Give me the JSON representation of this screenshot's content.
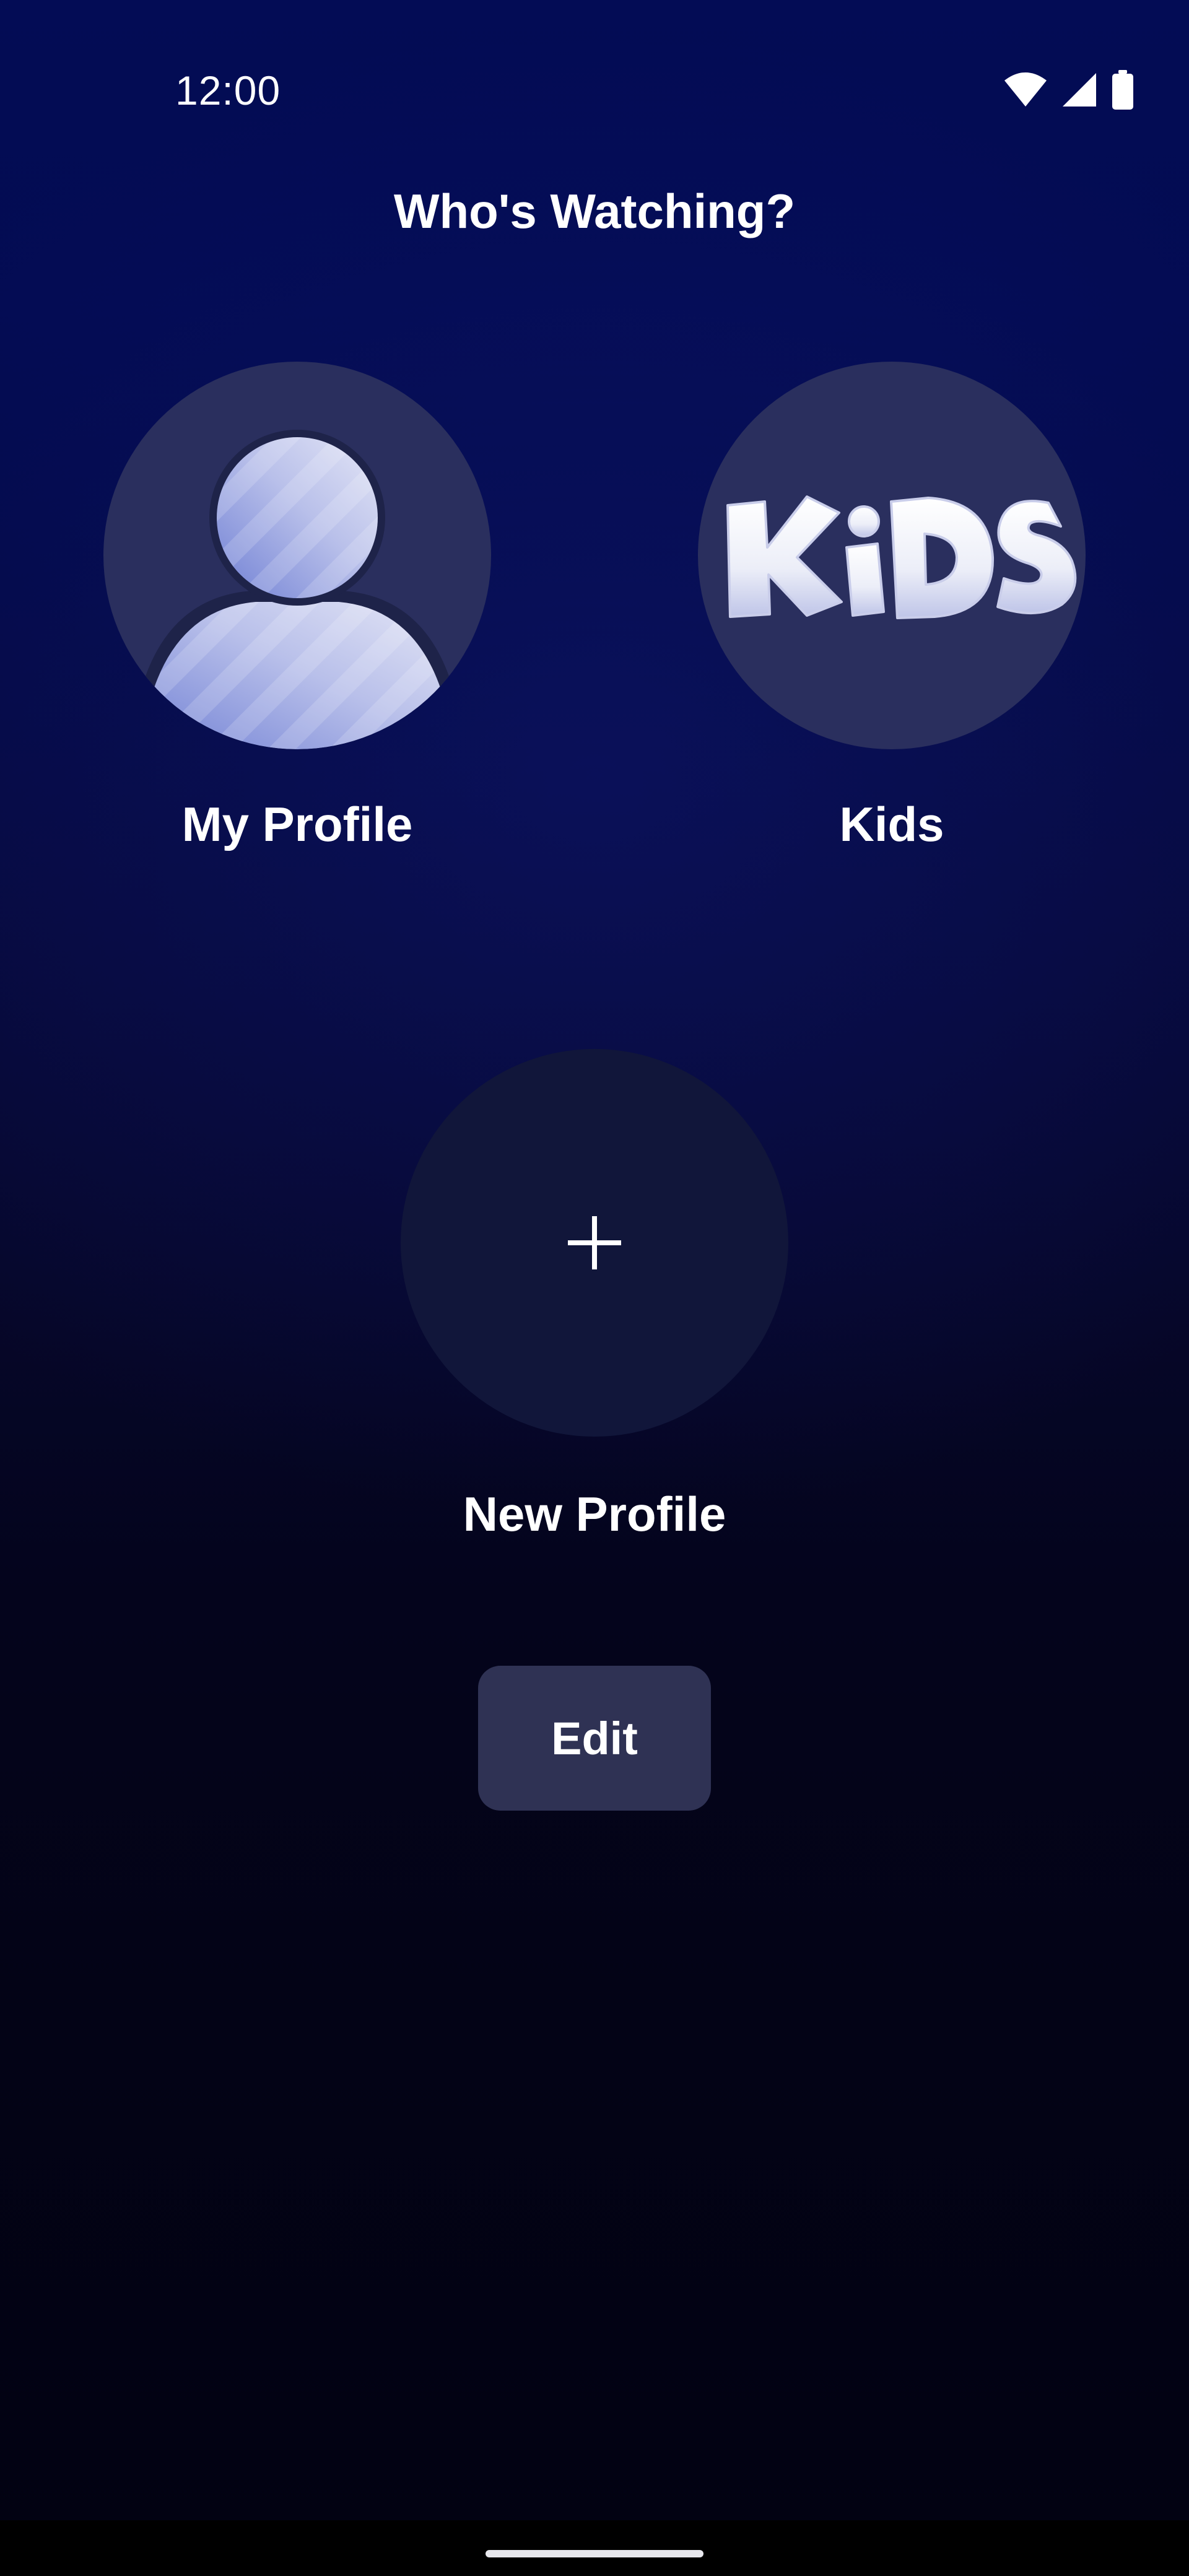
{
  "status_bar": {
    "time": "12:00",
    "icons": [
      "wifi-icon",
      "cellular-signal-icon",
      "battery-icon"
    ]
  },
  "page": {
    "title": "Who's Watching?"
  },
  "profiles": [
    {
      "label": "My Profile",
      "icon": "person-avatar-icon"
    },
    {
      "label": "Kids",
      "icon": "kids-logo-icon"
    },
    {
      "label": "New Profile",
      "icon": "plus-icon"
    }
  ],
  "actions": {
    "edit_label": "Edit"
  },
  "colors": {
    "background_top": "#030c55",
    "background_bottom": "#020212",
    "avatar_circle": "#2a2f5e",
    "new_profile_circle": "#11163a",
    "edit_button": "#2f3254",
    "text": "#ffffff"
  }
}
